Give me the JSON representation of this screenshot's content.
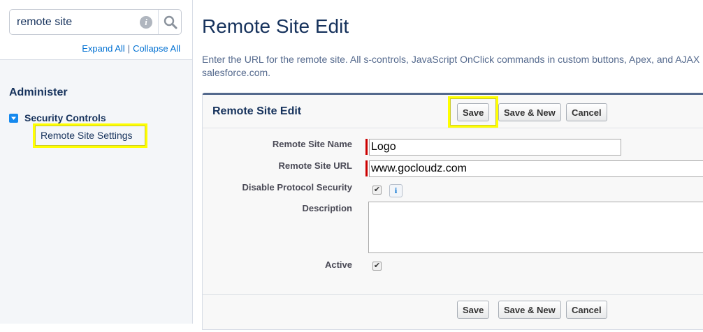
{
  "sidebar": {
    "search": {
      "value": "remote site",
      "placeholder": ""
    },
    "expand_all": "Expand All",
    "separator": "|",
    "collapse_all": "Collapse All",
    "section_title": "Administer",
    "group_label": "Security Controls",
    "active_item": "Remote Site Settings"
  },
  "main": {
    "page_title": "Remote Site Edit",
    "intro_line1": "Enter the URL for the remote site. All s-controls, JavaScript OnClick commands in custom buttons, Apex, and AJAX proxy calls can access these web addresses from",
    "intro_line2": "salesforce.com.",
    "panel": {
      "title": "Remote Site Edit",
      "buttons": {
        "save": "Save",
        "save_new": "Save & New",
        "cancel": "Cancel"
      },
      "fields": {
        "name_label": "Remote Site Name",
        "name_value": "Logo",
        "url_label": "Remote Site URL",
        "url_value": "www.gocloudz.com",
        "disable_label": "Disable Protocol Security",
        "description_label": "Description",
        "active_label": "Active"
      }
    }
  },
  "colors": {
    "highlight": "#ffff00",
    "link": "#0070d2",
    "required": "#cc0000"
  }
}
